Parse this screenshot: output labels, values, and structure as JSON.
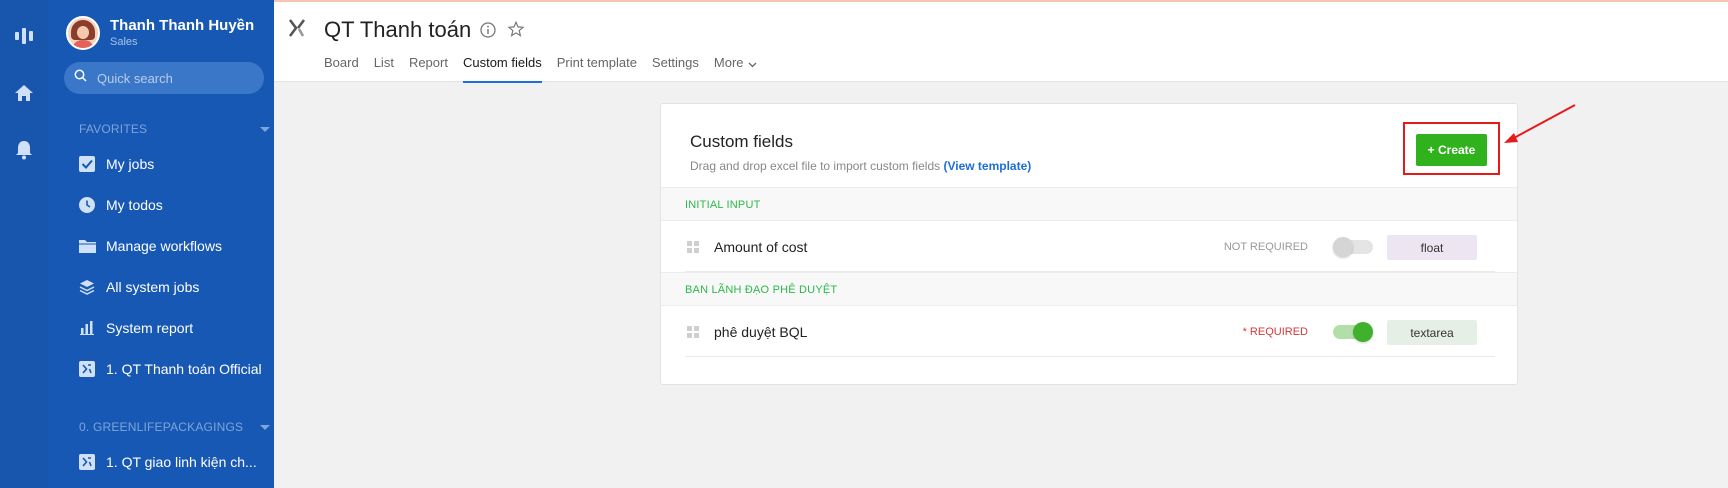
{
  "user": {
    "name": "Thanh Thanh Huyền",
    "role": "Sales"
  },
  "search": {
    "placeholder": "Quick search"
  },
  "sidebar": {
    "favorites_label": "FAVORITES",
    "favorites": [
      {
        "label": "My jobs",
        "icon": "checkbox-icon"
      },
      {
        "label": "My todos",
        "icon": "clock-icon"
      },
      {
        "label": "Manage workflows",
        "icon": "folder-icon"
      },
      {
        "label": "All system jobs",
        "icon": "layers-icon"
      },
      {
        "label": "System report",
        "icon": "bar-chart-icon"
      },
      {
        "label": "1. QT Thanh toán Official",
        "icon": "workflow-icon"
      }
    ],
    "group_label": "0. GREENLIFEPACKAGINGS",
    "group_items": [
      {
        "label": "1. QT giao linh kiện ch...",
        "icon": "workflow-icon"
      }
    ]
  },
  "header": {
    "title": "QT Thanh toán",
    "tabs": [
      {
        "label": "Board"
      },
      {
        "label": "List"
      },
      {
        "label": "Report"
      },
      {
        "label": "Custom fields",
        "active": true
      },
      {
        "label": "Print template"
      },
      {
        "label": "Settings"
      },
      {
        "label": "More"
      }
    ]
  },
  "card": {
    "title": "Custom fields",
    "subtitle": "Drag and drop excel file to import custom fields",
    "template_link": "(View template)",
    "create_label": "+ Create",
    "groups": [
      {
        "name": "INITIAL INPUT",
        "fields": [
          {
            "name": "Amount of cost",
            "required_label": "NOT REQUIRED",
            "required": false,
            "type": "float",
            "type_bg": "#ede6f2"
          }
        ]
      },
      {
        "name": "BAN LÃNH ĐẠO PHÊ DUYỆT",
        "fields": [
          {
            "name": "phê duyệt BQL",
            "required_label": "* REQUIRED",
            "required": true,
            "type": "textarea",
            "type_bg": "#e6efe6"
          }
        ]
      }
    ]
  },
  "colors": {
    "rail": "#1855ad",
    "sidebar": "#1758b4",
    "accent": "#1d6ddc",
    "create": "#30b21d",
    "highlight": "#e51b1b",
    "group_text": "#2bb84c"
  }
}
